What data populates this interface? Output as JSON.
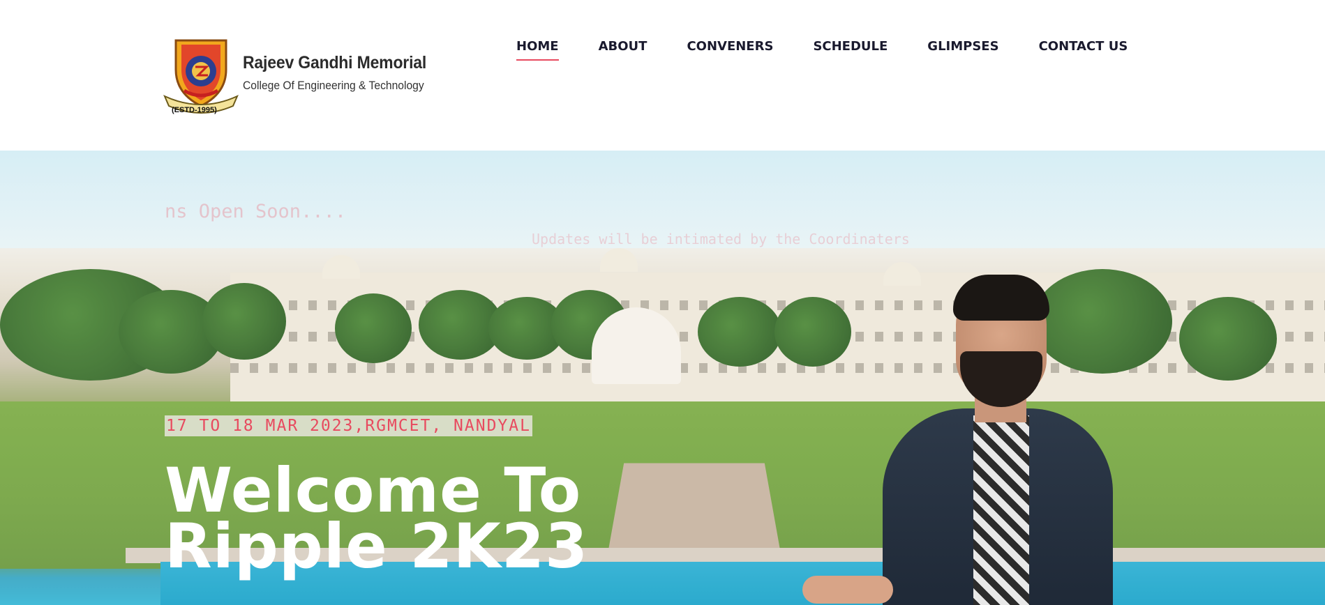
{
  "header": {
    "brand_title": "Rajeev Gandhi Memorial",
    "brand_subtitle": "College Of Engineering & Technology",
    "estd": "(ESTD-1995)"
  },
  "nav": {
    "items": [
      {
        "label": "HOME",
        "active": true
      },
      {
        "label": "ABOUT",
        "active": false
      },
      {
        "label": "CONVENERS",
        "active": false
      },
      {
        "label": "SCHEDULE",
        "active": false
      },
      {
        "label": "GLIMPSES",
        "active": false
      },
      {
        "label": "CONTACT US",
        "active": false
      }
    ]
  },
  "hero": {
    "faded_title": "ns Open Soon....",
    "faded_subtitle": "Updates will be intimated by the Coordinaters",
    "date_tag": "17 TO 18 MAR 2023,RGMCET, NANDYAL",
    "welcome_line1": "Welcome To",
    "welcome_line2": "Ripple 2K23"
  },
  "colors": {
    "accent": "#e84a5f",
    "nav_text": "#1a1a2e",
    "brand_text": "#2b2b2b",
    "hero_text": "#ffffff"
  }
}
